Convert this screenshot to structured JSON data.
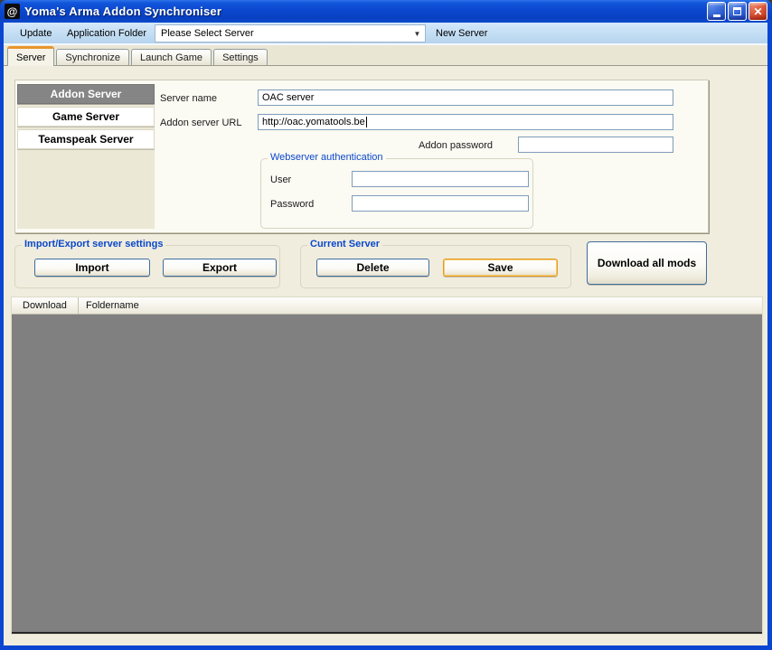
{
  "window": {
    "title": "Yoma's Arma Addon Synchroniser",
    "app_icon_glyph": "@",
    "close_glyph": "✕"
  },
  "toolbar": {
    "update": "Update",
    "application_folder": "Application Folder",
    "server_dropdown_value": "Please Select Server",
    "dropdown_arrow": "▼",
    "new_server": "New Server"
  },
  "tabs": [
    {
      "label": "Server",
      "active": true
    },
    {
      "label": "Synchronize",
      "active": false
    },
    {
      "label": "Launch Game",
      "active": false
    },
    {
      "label": "Settings",
      "active": false
    }
  ],
  "server_panel": {
    "sidebar": [
      {
        "label": "Addon Server",
        "selected": true
      },
      {
        "label": "Game Server",
        "selected": false
      },
      {
        "label": "Teamspeak Server",
        "selected": false
      }
    ],
    "server_name_label": "Server name",
    "server_name_value": "OAC server",
    "addon_url_label": "Addon server URL",
    "addon_url_value": "http://oac.yomatools.be",
    "addon_password_label": "Addon password",
    "addon_password_value": "",
    "webserver_auth": {
      "title": "Webserver authentication",
      "user_label": "User",
      "user_value": "",
      "password_label": "Password",
      "password_value": ""
    }
  },
  "import_export": {
    "title": "Import/Export server settings",
    "import_label": "Import",
    "export_label": "Export"
  },
  "current_server": {
    "title": "Current Server",
    "delete_label": "Delete",
    "save_label": "Save"
  },
  "download_all_label": "Download all mods",
  "mod_list": {
    "columns": [
      "Download",
      "Foldername"
    ],
    "rows": []
  },
  "colors": {
    "titlebar_blue": "#0b47cf",
    "window_border_blue": "#0b46d2",
    "toolbar_blue": "#c3ddf3",
    "client_beige": "#f0edde",
    "groupbox_title_blue": "#0a48cc",
    "save_focus_orange": "#e39b23",
    "selected_sidebar_gray": "#858585",
    "list_gray": "#808080",
    "close_red": "#c23818",
    "active_tab_orange": "#e8952f"
  }
}
